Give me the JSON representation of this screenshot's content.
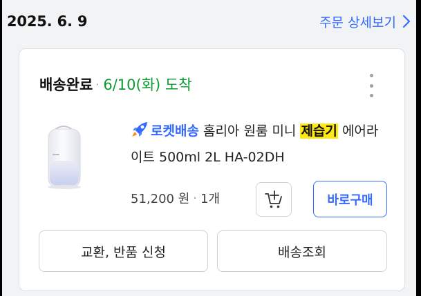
{
  "order": {
    "date": "2025. 6. 9",
    "detail_link": "주문 상세보기"
  },
  "shipment": {
    "status": "배송완료",
    "separator": "·",
    "arrival": "6/10(화) 도착"
  },
  "product": {
    "rocket_label": "로켓배송",
    "name_before": " 홈리아 원룸 미니 ",
    "name_highlight": "제습기",
    "name_after": " 에어라이트 500ml 2L HA-02DH",
    "price": "51,200 원",
    "separator": "·",
    "quantity": "1개"
  },
  "buttons": {
    "buy_now": "바로구매",
    "exchange_return": "교환, 반품 신청",
    "track_delivery": "배송조회"
  },
  "icons": {
    "detail": "chevron-right-icon",
    "more": "more-vertical-icon",
    "rocket": "rocket-icon",
    "cart": "add-to-cart-icon"
  },
  "colors": {
    "accent": "#346aff",
    "arrival_green": "#0a9b30",
    "highlight": "#ffe914"
  }
}
